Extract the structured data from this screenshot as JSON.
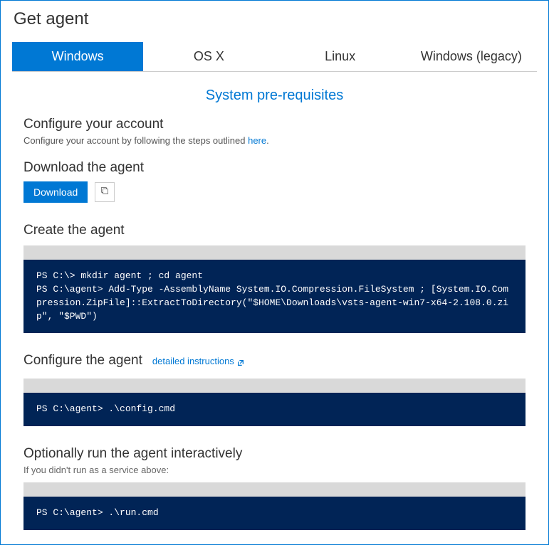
{
  "page_title": "Get agent",
  "tabs": [
    {
      "label": "Windows",
      "active": true
    },
    {
      "label": "OS X",
      "active": false
    },
    {
      "label": "Linux",
      "active": false
    },
    {
      "label": "Windows (legacy)",
      "active": false
    }
  ],
  "prereq_link": "System pre-requisites",
  "configure_account": {
    "heading": "Configure your account",
    "desc_prefix": "Configure your account by following the steps outlined ",
    "desc_link": "here",
    "desc_suffix": "."
  },
  "download_agent": {
    "heading": "Download the agent",
    "button": "Download"
  },
  "create_agent": {
    "heading": "Create the agent",
    "code": "PS C:\\> mkdir agent ; cd agent\nPS C:\\agent> Add-Type -AssemblyName System.IO.Compression.FileSystem ; [System.IO.Compression.ZipFile]::ExtractToDirectory(\"$HOME\\Downloads\\vsts-agent-win7-x64-2.108.0.zip\", \"$PWD\")"
  },
  "configure_agent": {
    "heading": "Configure the agent",
    "link": "detailed instructions",
    "code": "PS C:\\agent> .\\config.cmd"
  },
  "run_agent": {
    "heading": "Optionally run the agent interactively",
    "subtext": "If you didn't run as a service above:",
    "code": "PS C:\\agent> .\\run.cmd"
  }
}
